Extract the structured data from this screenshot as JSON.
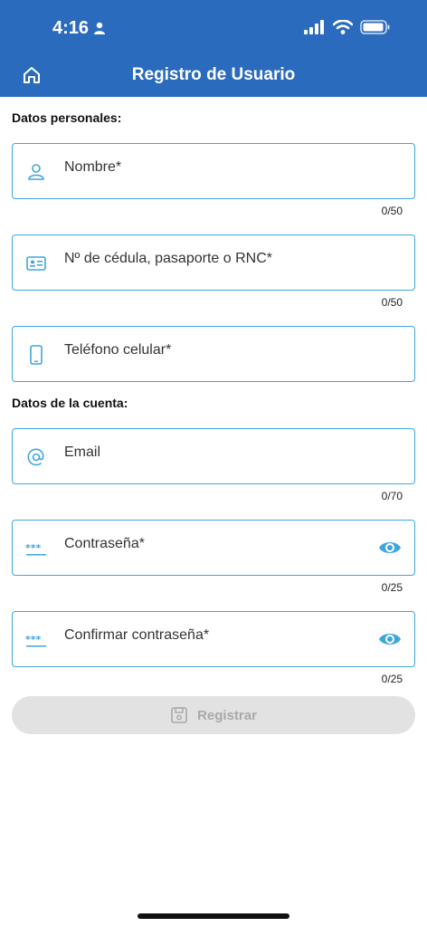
{
  "status_bar": {
    "time": "4:16"
  },
  "nav": {
    "title": "Registro de Usuario"
  },
  "sections": {
    "personal": "Datos personales:",
    "account": "Datos de la cuenta:"
  },
  "fields": {
    "nombre": {
      "placeholder": "Nombre*",
      "counter": "0/50",
      "icon": "person-icon"
    },
    "cedula": {
      "placeholder": "Nº de cédula, pasaporte o RNC*",
      "counter": "0/50",
      "icon": "id-card-icon"
    },
    "telefono": {
      "placeholder": "Teléfono celular*",
      "icon": "phone-icon"
    },
    "email": {
      "placeholder": "Email",
      "counter": "0/70",
      "icon": "at-icon"
    },
    "password": {
      "placeholder": "Contraseña*",
      "counter": "0/25",
      "icon": "password-icon",
      "action_icon": "eye-icon"
    },
    "confirm": {
      "placeholder": "Confirmar contraseña*",
      "counter": "0/25",
      "icon": "password-icon",
      "action_icon": "eye-icon"
    }
  },
  "submit": {
    "label": "Registrar",
    "icon": "save-icon",
    "enabled": false
  },
  "colors": {
    "header": "#2a6bbd",
    "accent": "#3ea6dc",
    "disabled_bg": "#e2e2e2",
    "disabled_text": "#a9a9a9"
  }
}
